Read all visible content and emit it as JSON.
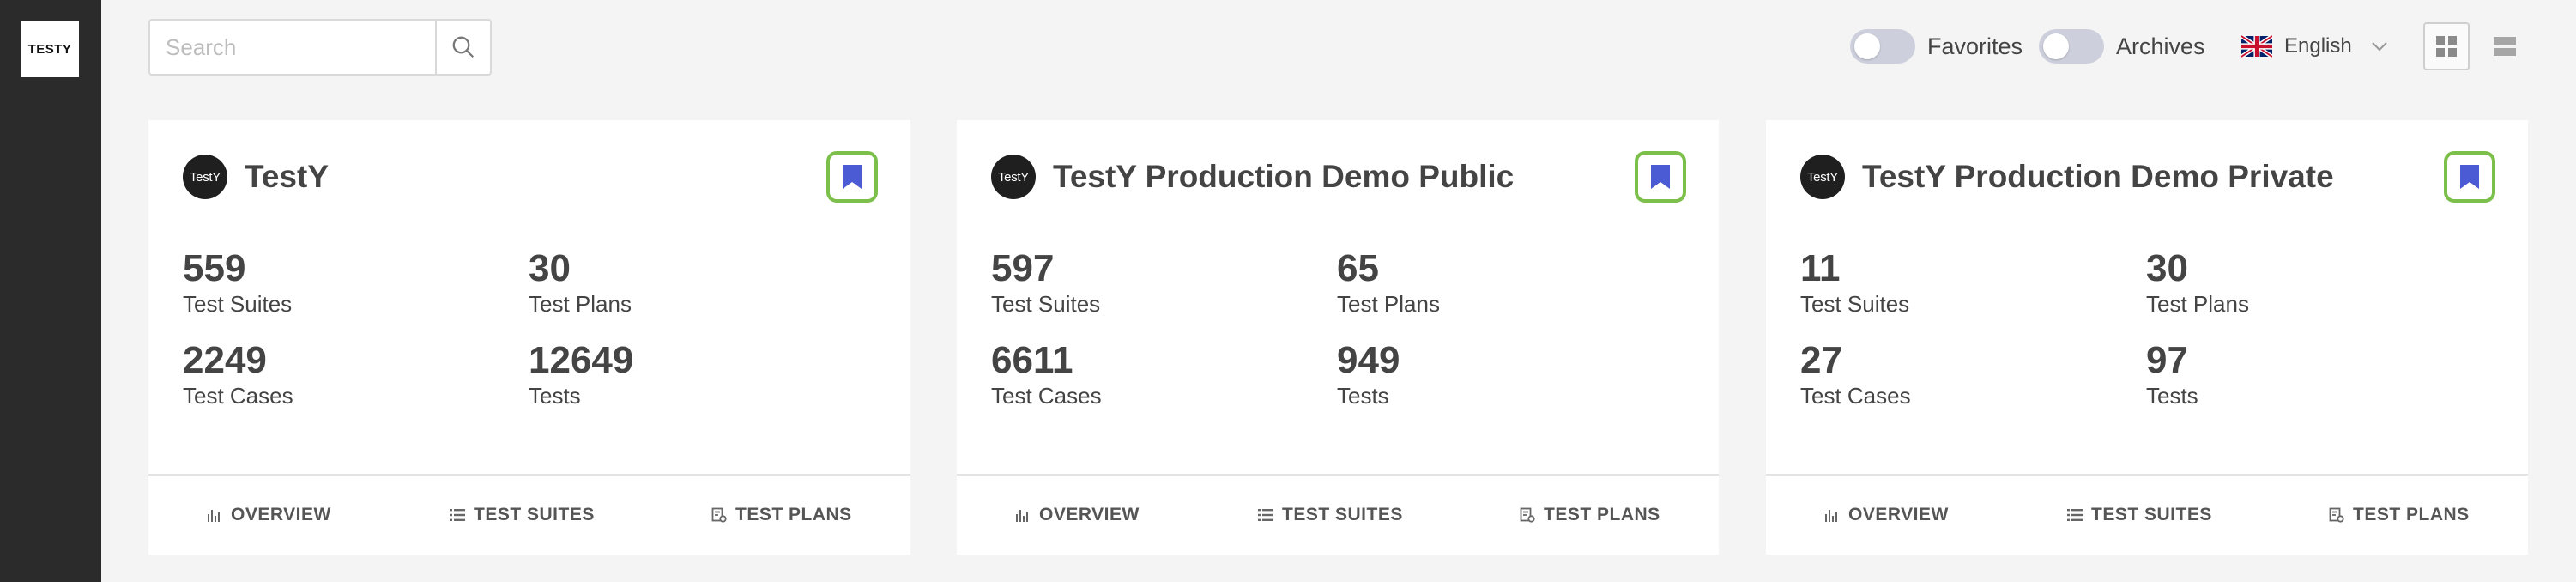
{
  "app": {
    "logo_text": "TESTY"
  },
  "search": {
    "placeholder": "Search",
    "value": ""
  },
  "filters": {
    "favorites_label": "Favorites",
    "archives_label": "Archives"
  },
  "language": {
    "label": "English"
  },
  "projects": [
    {
      "avatar": "TestY",
      "title": "TestY",
      "stats": {
        "test_suites": {
          "value": "559",
          "label": "Test Suites"
        },
        "test_plans": {
          "value": "30",
          "label": "Test Plans"
        },
        "test_cases": {
          "value": "2249",
          "label": "Test Cases"
        },
        "tests": {
          "value": "12649",
          "label": "Tests"
        }
      },
      "links": {
        "overview": "OVERVIEW",
        "test_suites": "TEST SUITES",
        "test_plans": "TEST PLANS"
      }
    },
    {
      "avatar": "TestY",
      "title": "TestY Production Demo Public",
      "stats": {
        "test_suites": {
          "value": "597",
          "label": "Test Suites"
        },
        "test_plans": {
          "value": "65",
          "label": "Test Plans"
        },
        "test_cases": {
          "value": "6611",
          "label": "Test Cases"
        },
        "tests": {
          "value": "949",
          "label": "Tests"
        }
      },
      "links": {
        "overview": "OVERVIEW",
        "test_suites": "TEST SUITES",
        "test_plans": "TEST PLANS"
      }
    },
    {
      "avatar": "TestY",
      "title": "TestY Production Demo Private",
      "stats": {
        "test_suites": {
          "value": "11",
          "label": "Test Suites"
        },
        "test_plans": {
          "value": "30",
          "label": "Test Plans"
        },
        "test_cases": {
          "value": "27",
          "label": "Test Cases"
        },
        "tests": {
          "value": "97",
          "label": "Tests"
        }
      },
      "links": {
        "overview": "OVERVIEW",
        "test_suites": "TEST SUITES",
        "test_plans": "TEST PLANS"
      }
    }
  ]
}
